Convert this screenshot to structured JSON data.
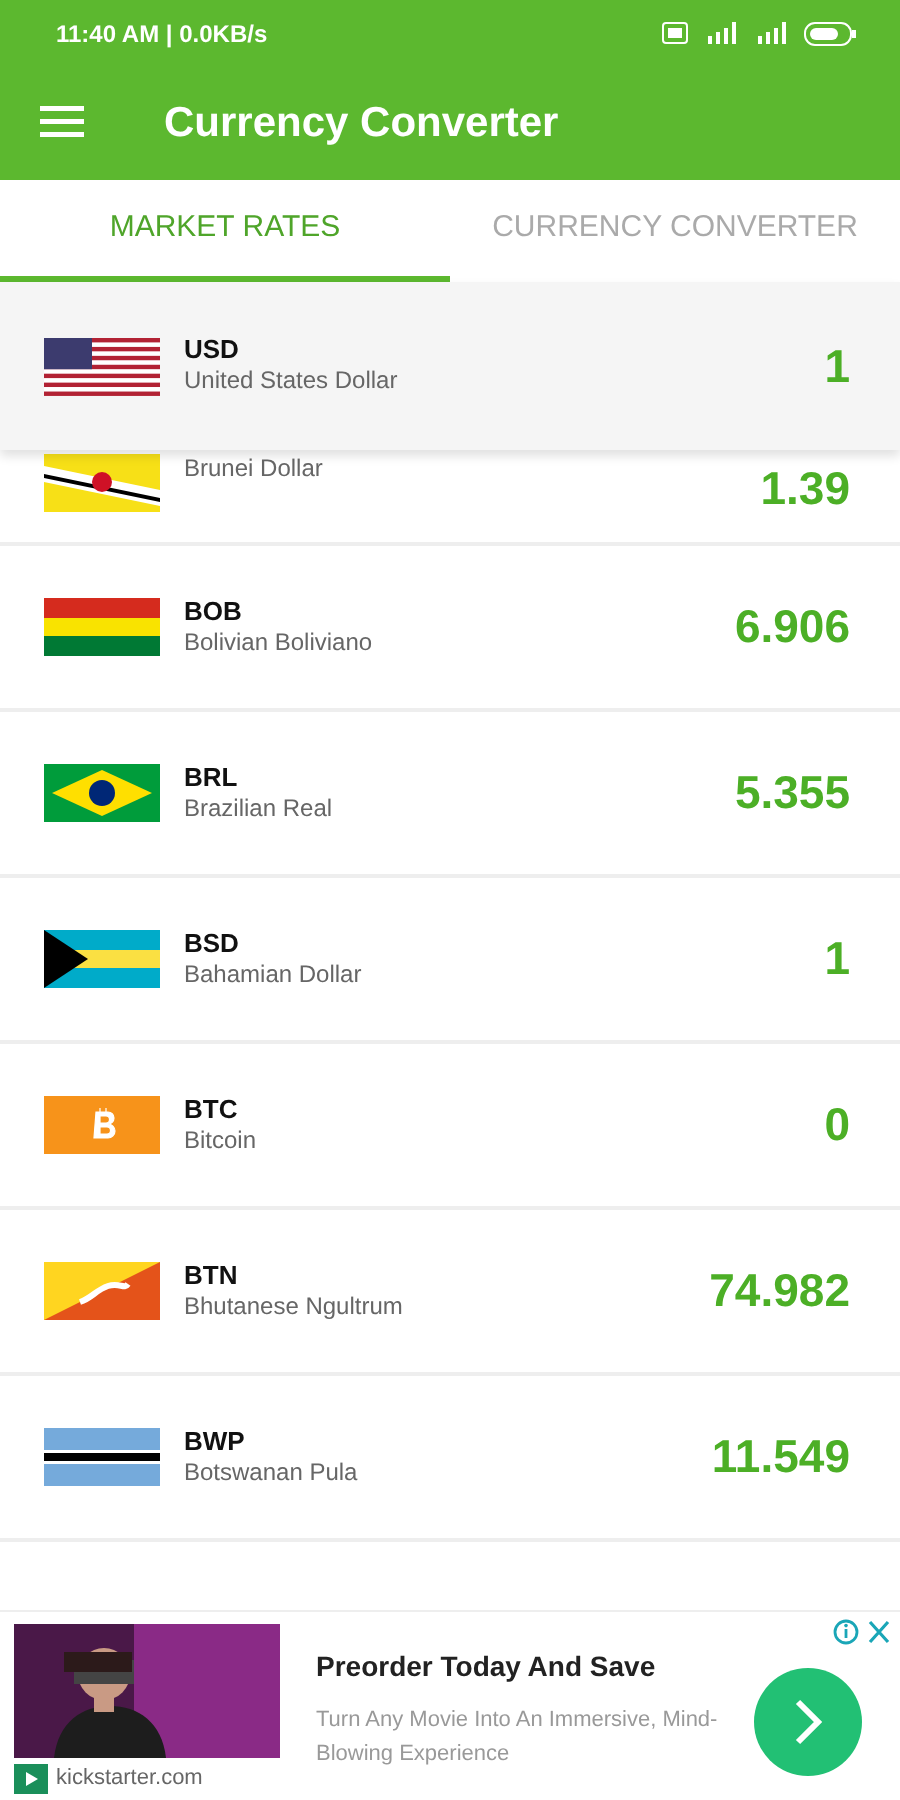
{
  "status_bar": {
    "time": "11:40 AM | 0.0KB/s"
  },
  "app_bar": {
    "title": "Currency Converter"
  },
  "tabs": [
    {
      "label": "MARKET RATES",
      "selected": true
    },
    {
      "label": "CURRENCY CONVERTER",
      "selected": false
    }
  ],
  "pinned": {
    "code": "USD",
    "name": "United States Dollar",
    "value": "1"
  },
  "rates": [
    {
      "name": "Brunei Dollar",
      "value": "1.39"
    },
    {
      "code": "BOB",
      "name": "Bolivian Boliviano",
      "value": "6.906"
    },
    {
      "code": "BRL",
      "name": "Brazilian Real",
      "value": "5.355"
    },
    {
      "code": "BSD",
      "name": "Bahamian Dollar",
      "value": "1"
    },
    {
      "code": "BTC",
      "name": "Bitcoin",
      "value": "0"
    },
    {
      "code": "BTN",
      "name": "Bhutanese Ngultrum",
      "value": "74.982"
    },
    {
      "code": "BWP",
      "name": "Botswanan Pula",
      "value": "11.549"
    }
  ],
  "ad": {
    "headline": "Preorder Today And Save",
    "body": "Turn Any Movie Into An Immersive, Mind-Blowing Experience",
    "domain": "kickstarter.com"
  }
}
